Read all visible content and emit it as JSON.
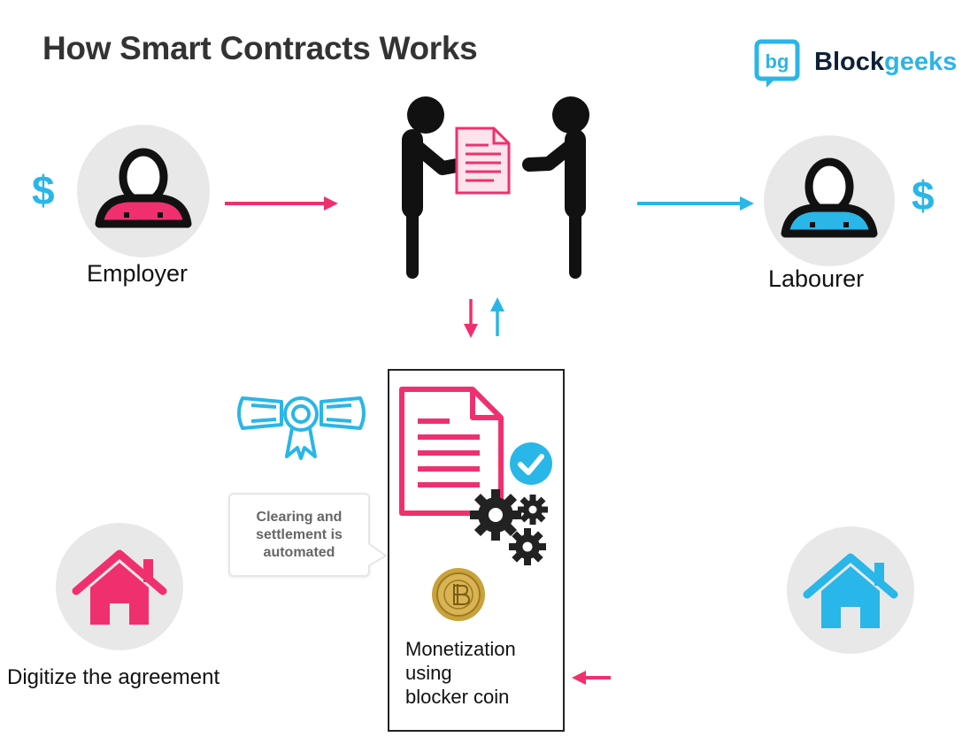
{
  "title": "How Smart Contracts Works",
  "brand": {
    "part1": "Block",
    "part2": "geeks",
    "logo_icon": "blockgeeks-logo-icon"
  },
  "employer": {
    "label": "Employer",
    "currency_symbol": "$",
    "color": "#f0306e"
  },
  "labourer": {
    "label": "Labourer",
    "currency_symbol": "$",
    "color": "#29b6e8"
  },
  "bubble_lines": [
    "Clearing and",
    "settlement is",
    "automated"
  ],
  "monetization_lines": [
    "Monetization",
    "using",
    "blocker coin"
  ],
  "digitize_label": "Digitize the agreement",
  "colors": {
    "pink": "#f0306e",
    "blue": "#29b6e8",
    "grey_circle": "#e8e8e8",
    "dark": "#111111"
  }
}
